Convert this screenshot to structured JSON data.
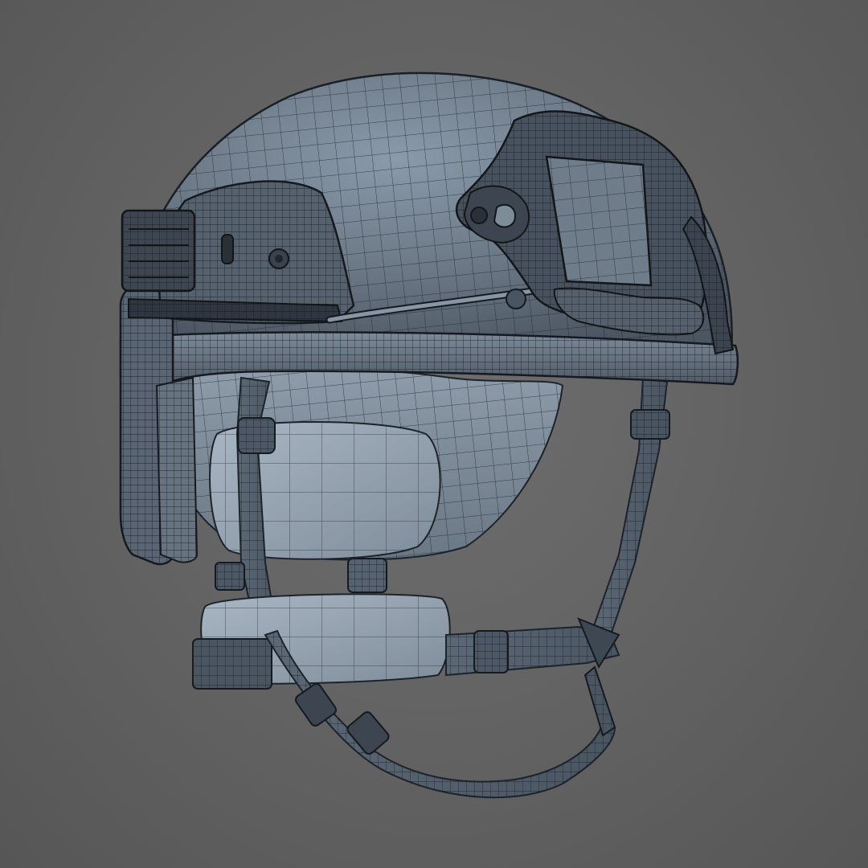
{
  "scene": {
    "subject": "helmet-wireframe",
    "colors": {
      "background": "#636363",
      "shell": "#5f6b78",
      "shell_light": "#8494a4",
      "padding": "#9aa8b6",
      "wire": "#1c232b",
      "strap": "#556270",
      "dark": "#2a3038"
    }
  }
}
